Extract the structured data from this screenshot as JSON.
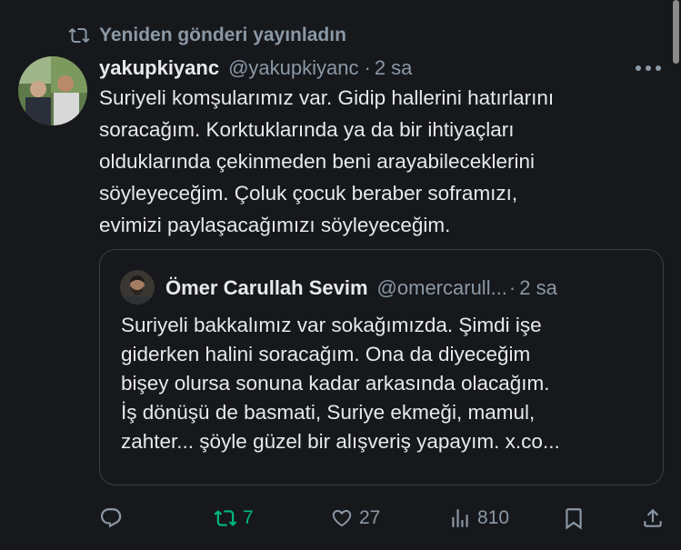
{
  "repost": {
    "label": "Yeniden gönderi yayınladın",
    "icon": "repost-icon"
  },
  "tweet": {
    "author_name": "yakupkiyanc",
    "handle": "@yakupkiyanc",
    "separator": "·",
    "time": "2 sa",
    "text": "Suriyeli komşularımız var. Gidip hallerini hatırlarını\nsoracağım. Korktuklarında ya da bir ihtiyaçları\nolduklarında çekinmeden beni arayabileceklerini\nsöyleyeceğim. Çoluk çocuk beraber soframızı,\nevimizi paylaşacağımızı söyleyeceğim.",
    "more_icon": "more-icon"
  },
  "quote": {
    "author_name": "Ömer Carullah Sevim",
    "handle": "@omercarull...",
    "separator": "·",
    "time": "2 sa",
    "text": "Suriyeli bakkalımız var sokağımızda. Şimdi işe\ngiderken halini soracağım. Ona da diyeceğim\nbişey olursa sonuna kadar arkasında olacağım.\nİş dönüşü de basmati, Suriye ekmeği, mamul,\nzahter... şöyle güzel bir alışveriş yapayım. x.co..."
  },
  "actions": {
    "reply_icon": "reply-icon",
    "retweet_count": "7",
    "like_count": "27",
    "views_count": "810",
    "bookmark_icon": "bookmark-icon",
    "share_icon": "share-icon"
  },
  "colors": {
    "background": "#16181c",
    "text": "#e7e9ea",
    "muted": "#8b98a5",
    "retweet_active": "#00ba7c",
    "border": "#3a3f45"
  }
}
